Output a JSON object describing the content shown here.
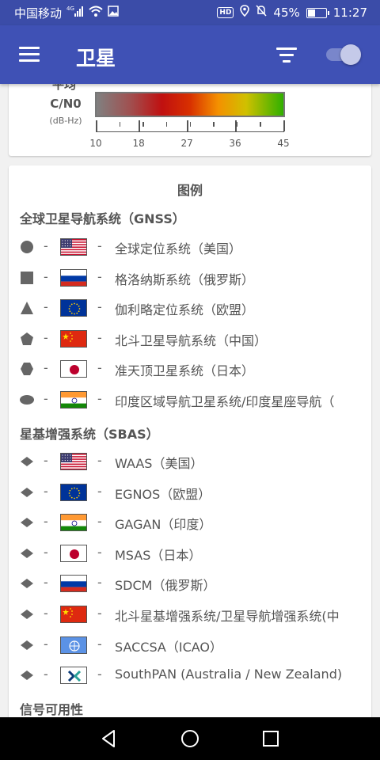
{
  "status_bar": {
    "carrier": "中国移动",
    "network": "4G",
    "battery": "45%",
    "battery_level": 0.45,
    "time": "11:27",
    "icons": [
      "signal-icon",
      "wifi-icon",
      "image-icon",
      "hd-icon",
      "location-icon",
      "mute-icon",
      "battery-icon"
    ]
  },
  "app_bar": {
    "title": "卫星",
    "icons": [
      "menu-icon",
      "filter-icon",
      "toggle-switch"
    ],
    "toggle_on": true
  },
  "cn0_card": {
    "label_top": "平均",
    "label": "C/N0",
    "unit": "(dB-Hz)",
    "ticks": [
      "10",
      "18",
      "27",
      "36",
      "45"
    ]
  },
  "legend": {
    "title": "图例",
    "gnss_heading": "全球卫星导航系统（GNSS）",
    "gnss": [
      {
        "shape": "circle",
        "flag": "usa",
        "label": "全球定位系统（美国）"
      },
      {
        "shape": "square",
        "flag": "russia",
        "label": "格洛纳斯系统（俄罗斯）"
      },
      {
        "shape": "triangle",
        "flag": "eu",
        "label": "伽利略定位系统（欧盟）"
      },
      {
        "shape": "pentagon",
        "flag": "china",
        "label": "北斗卫星导航系统（中国）"
      },
      {
        "shape": "hexagon",
        "flag": "japan",
        "label": "准天顶卫星系统（日本）"
      },
      {
        "shape": "oval",
        "flag": "india",
        "label": "印度区域导航卫星系统/印度星座导航（"
      }
    ],
    "sbas_heading": "星基增强系统（SBAS）",
    "sbas": [
      {
        "shape": "diamond",
        "flag": "usa",
        "label": "WAAS（美国）"
      },
      {
        "shape": "diamond",
        "flag": "eu",
        "label": "EGNOS（欧盟）"
      },
      {
        "shape": "diamond",
        "flag": "india",
        "label": "GAGAN（印度）"
      },
      {
        "shape": "diamond",
        "flag": "japan",
        "label": "MSAS（日本）"
      },
      {
        "shape": "diamond",
        "flag": "russia",
        "label": "SDCM（俄罗斯）"
      },
      {
        "shape": "diamond",
        "flag": "china",
        "label": "北斗星基增强系统/卫星导航增强系统(中"
      },
      {
        "shape": "diamond",
        "flag": "icao",
        "label": "SACCSA（ICAO）"
      },
      {
        "shape": "diamond",
        "flag": "southpan",
        "label": "SouthPAN (Australia / New Zealand)"
      }
    ],
    "signal_heading": "信号可用性"
  },
  "nav_bar": {
    "icons": [
      "back-icon",
      "home-icon",
      "recents-icon"
    ]
  },
  "colors": {
    "primary": "#3f51b5",
    "status_bar": "#3b4ca8",
    "shape_gray": "#666666"
  }
}
